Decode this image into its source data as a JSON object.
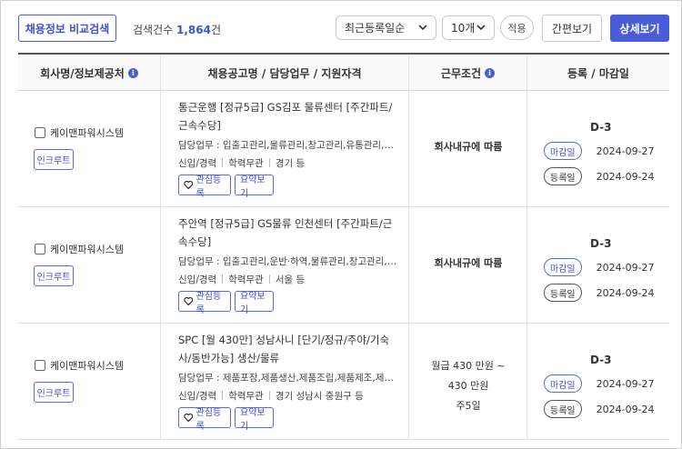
{
  "toolbar": {
    "compare_button": "채용정보 비교검색",
    "count_label": "검색건수",
    "count_value": "1,864",
    "count_unit": "건",
    "sort_select": "최근등록일순",
    "size_select": "10개",
    "apply_button": "적용",
    "simple_view_button": "간편보기",
    "detail_view_button": "상세보기"
  },
  "table": {
    "headers": {
      "company": "회사명/정보제공처",
      "job": "채용공고명 / 담당업무 / 지원자격",
      "condition": "근무조건",
      "dates": "등록 / 마감일"
    },
    "rows": [
      {
        "company": "케이맨파워시스템",
        "source": "인크루트",
        "title": "통근운행 [정규5급] GS김포 물류센터 [주간파트/근속수당]",
        "duty": "담당업무 : 입출고관리,물류관리,창고관리,유통관리,일...",
        "experience": "신입/경력",
        "education": "학력무관",
        "location": "경기 등",
        "fav_button": "관심등록",
        "summary_button": "요약보기",
        "condition": "회사내규에 따름",
        "dday": "D-3",
        "deadline_label": "마감일",
        "deadline": "2024-09-27",
        "reg_label": "등록일",
        "registered": "2024-09-24"
      },
      {
        "company": "케이맨파워시스템",
        "source": "인크루트",
        "title": "주안역 [정규5급] GS물류 인천센터 [주간파트/근속수당]",
        "duty": "담당업무 : 입출고관리,운반·하역,물류관리,창고관리,유...",
        "experience": "신입/경력",
        "education": "학력무관",
        "location": "서울 등",
        "fav_button": "관심등록",
        "summary_button": "요약보기",
        "condition": "회사내규에 따름",
        "dday": "D-3",
        "deadline_label": "마감일",
        "deadline": "2024-09-27",
        "reg_label": "등록일",
        "registered": "2024-09-24"
      },
      {
        "company": "케이맨파워시스템",
        "source": "인크루트",
        "title": "SPC [월 430만] 성남사니 [단기/정규/주야/기숙사/동반가능] 생산/물류",
        "duty": "담당업무 : 제품포장,제품생산,제품조립,제품제조,제품...",
        "experience": "신입/경력",
        "education": "학력무관",
        "location": "경기 성남시 중원구 등",
        "fav_button": "관심등록",
        "summary_button": "요약보기",
        "condition_line1": "월급 430 만원 ~",
        "condition_line2": "430 만원",
        "condition_line3": "주5일",
        "dday": "D-3",
        "deadline_label": "마감일",
        "deadline": "2024-09-27",
        "reg_label": "등록일",
        "registered": "2024-09-24"
      }
    ]
  },
  "colors": {
    "accent": "#4a5dd9",
    "accent_text": "#3e4fd1",
    "count_number": "#3b56c8"
  },
  "icons": {
    "info": "info-icon",
    "heart": "heart-icon",
    "dropdown": "chevron-down-icon"
  }
}
